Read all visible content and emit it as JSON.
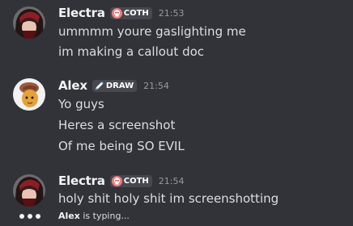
{
  "messages": [
    {
      "username": "Electra",
      "tag": "COTH",
      "tag_icon": "skull-icon",
      "timestamp": "21:53",
      "lines": [
        "ummmm youre gaslighting me",
        "im making a callout doc"
      ]
    },
    {
      "username": "Alex",
      "tag": "DRAW",
      "tag_icon": "pencil-icon",
      "timestamp": "21:54",
      "lines": [
        "Yo guys",
        "Heres a screenshot",
        "Of me being SO EVIL"
      ]
    },
    {
      "username": "Electra",
      "tag": "COTH",
      "tag_icon": "skull-icon",
      "timestamp": "21:54",
      "lines": [
        "holy shit holy shit im screenshotting"
      ]
    }
  ],
  "typing": {
    "name": "Alex",
    "text": "is typing..."
  },
  "colors": {
    "background": "#313338",
    "username": "#f2f3f5",
    "message": "#dbdee1",
    "timestamp": "#949ba4",
    "tag_bg": "#47484f",
    "skull": "#f47b7b"
  }
}
